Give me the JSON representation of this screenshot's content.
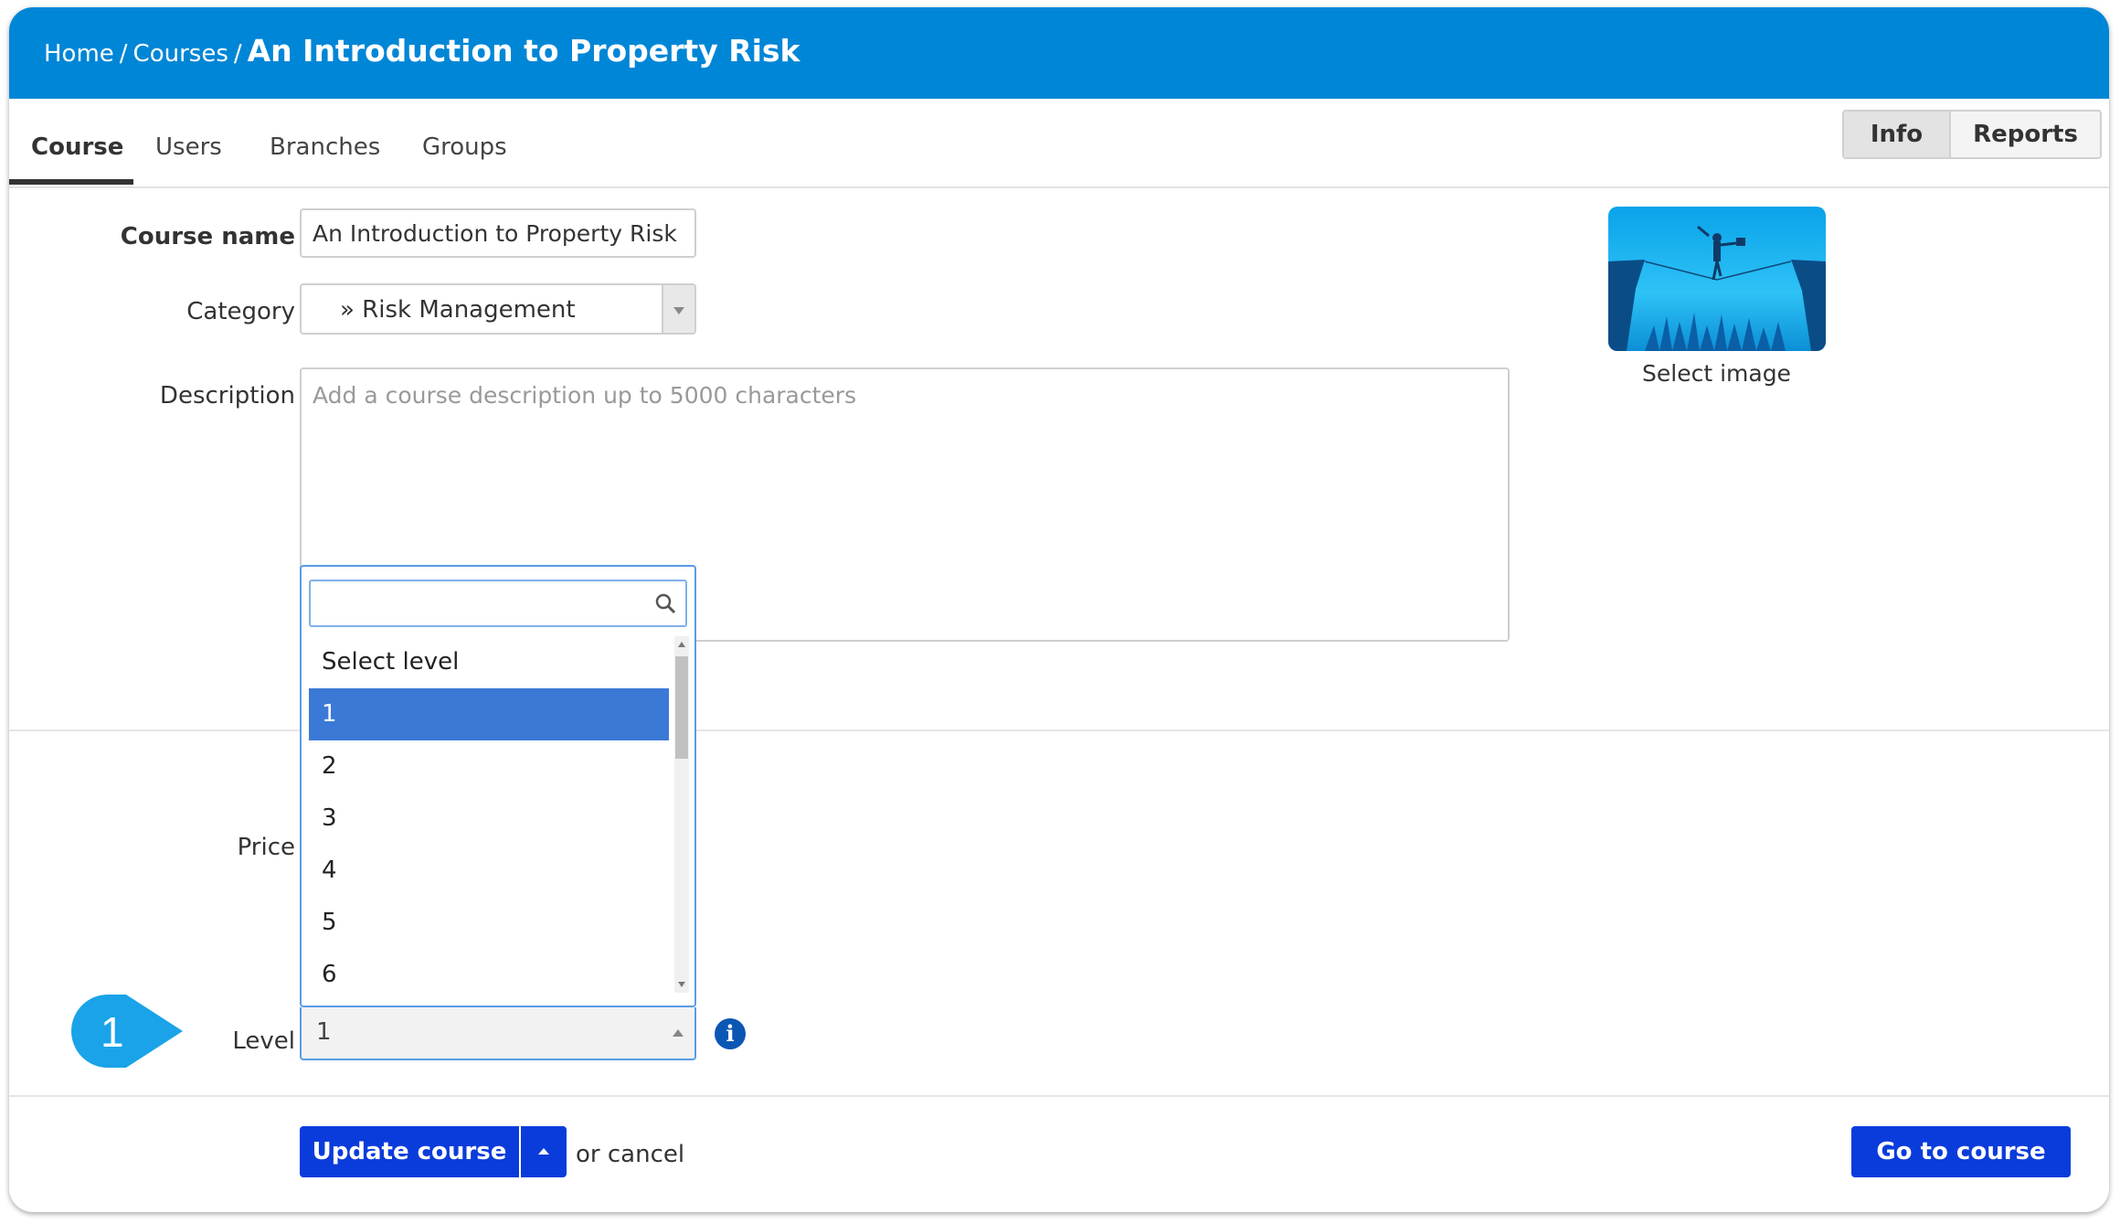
{
  "breadcrumb": {
    "home": "Home",
    "courses": "Courses",
    "current": "An Introduction to Property Risk",
    "separator": "/"
  },
  "tabs": [
    {
      "label": "Course",
      "active": true
    },
    {
      "label": "Users",
      "active": false
    },
    {
      "label": "Branches",
      "active": false
    },
    {
      "label": "Groups",
      "active": false
    }
  ],
  "view_toggle": {
    "info": "Info",
    "reports": "Reports",
    "selected": "Info"
  },
  "form": {
    "course_name_label": "Course name",
    "course_name_value": "An Introduction to Property Risk",
    "category_label": "Category",
    "category_value": "» Risk Management",
    "description_label": "Description",
    "description_placeholder": "Add a course description up to 5000 characters",
    "price_label": "Price",
    "level_label": "Level",
    "level_value": "1"
  },
  "image": {
    "select_label": "Select image",
    "icon": "image-thumbnail"
  },
  "level_dropdown": {
    "search_icon": "search-icon",
    "options": [
      "Select level",
      "1",
      "2",
      "3",
      "4",
      "5",
      "6"
    ],
    "selected": "1"
  },
  "callout": {
    "number": "1",
    "color": "#1aa3e8"
  },
  "actions": {
    "update_course": "Update course",
    "or_cancel": "or cancel",
    "go_to_course": "Go to course"
  },
  "colors": {
    "header": "#0086d6",
    "primary_button": "#0a3cdb",
    "selected_option": "#3b79d6",
    "info_icon": "#0b57b4"
  }
}
